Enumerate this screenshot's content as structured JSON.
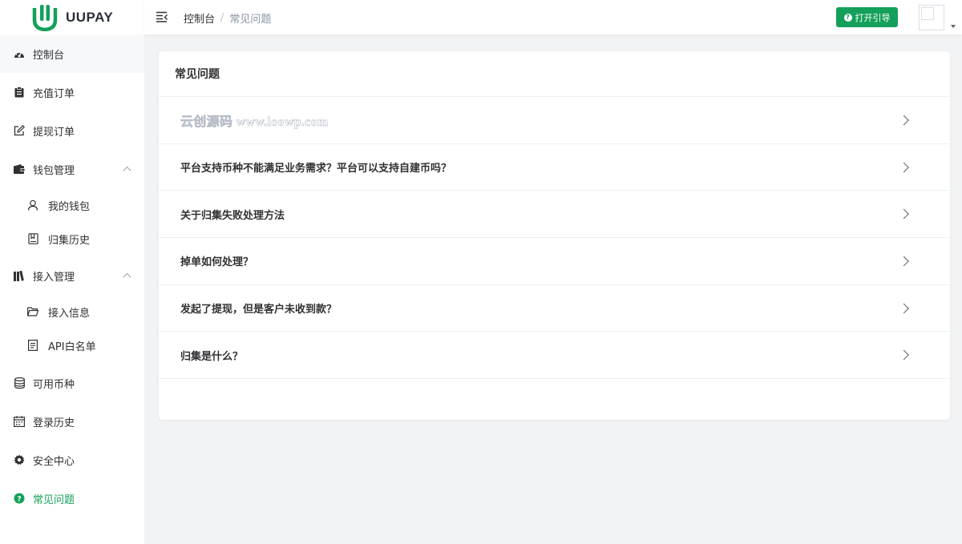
{
  "brand": {
    "name": "UUPAY",
    "accent": "#14a05a"
  },
  "header": {
    "breadcrumb_home": "控制台",
    "breadcrumb_sep": "/",
    "breadcrumb_current": "常见问题",
    "guide_button": "打开引导"
  },
  "sidebar": {
    "items": [
      {
        "label": "控制台",
        "icon": "dashboard-icon"
      },
      {
        "label": "充值订单",
        "icon": "clipboard-icon"
      },
      {
        "label": "提现订单",
        "icon": "edit-icon"
      },
      {
        "label": "钱包管理",
        "icon": "wallet-icon",
        "expanded": true
      },
      {
        "label": "我的钱包",
        "icon": "user-icon"
      },
      {
        "label": "归集历史",
        "icon": "book-icon"
      },
      {
        "label": "接入管理",
        "icon": "library-icon",
        "expanded": true
      },
      {
        "label": "接入信息",
        "icon": "folder-icon"
      },
      {
        "label": "API白名单",
        "icon": "document-icon"
      },
      {
        "label": "可用币种",
        "icon": "database-icon"
      },
      {
        "label": "登录历史",
        "icon": "calendar-icon"
      },
      {
        "label": "安全中心",
        "icon": "gear-icon"
      },
      {
        "label": "常见问题",
        "icon": "question-icon",
        "active": true
      }
    ]
  },
  "card": {
    "title": "常见问题",
    "watermark": "云创源码 www.loowp.com",
    "faqs": [
      "平台支持币种不能满足业务需求？平台可以支持自建币吗？",
      "关于归集失败处理方法",
      "掉单如何处理？",
      "发起了提现，但是客户未收到款？",
      "归集是什么？"
    ]
  }
}
